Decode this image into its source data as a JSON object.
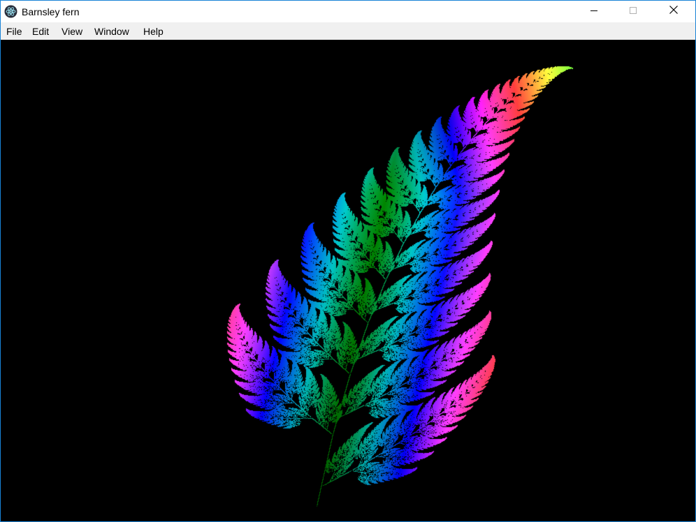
{
  "window": {
    "title": "Barnsley fern",
    "app_icon": "electron-atom-icon",
    "controls": {
      "minimize_icon": "minimize-icon",
      "maximize_icon": "maximize-icon",
      "close_icon": "close-icon"
    }
  },
  "menu": {
    "items": [
      {
        "label": "File"
      },
      {
        "label": "Edit"
      },
      {
        "label": "View"
      },
      {
        "label": "Window"
      },
      {
        "label": "Help"
      }
    ]
  },
  "canvas": {
    "background": "#000000",
    "content": "barnsley-fern-fractal"
  },
  "colors": {
    "window_border": "#1883d7",
    "menubar": "#f0f0f0",
    "titlebar": "#ffffff"
  }
}
